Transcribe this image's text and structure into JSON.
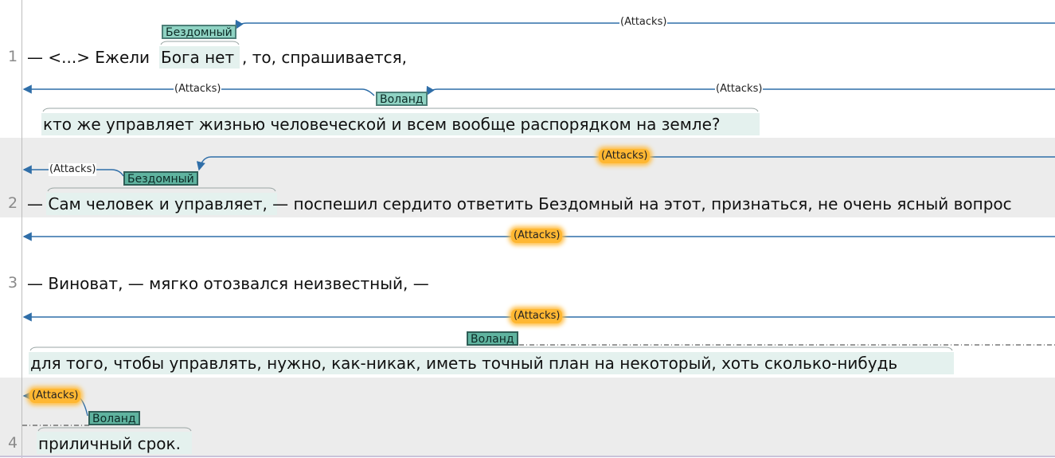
{
  "lines": [
    {
      "number": "1"
    },
    {
      "number": "2"
    },
    {
      "number": "3"
    },
    {
      "number": "4"
    }
  ],
  "sentences": {
    "s1a": "— <...> Ежели",
    "s1b": "Бога нет",
    "s1c": ", то, спрашивается,",
    "s1d": "кто же управляет жизнью человеческой и всем вообще распорядком на земле?",
    "s2a": "— Сам человек и управляет, — поспешил сердито ответить Бездомный на этот, признаться, не очень ясный вопрос",
    "s3a": "— Виноват, — мягко отозвался неизвестный, —",
    "s3b": "для того, чтобы управлять, нужно, как-никак, иметь точный план на некоторый, хоть сколько-нибудь",
    "s4a": "приличный срок."
  },
  "entities": {
    "e1": "Бездомный",
    "e2": "Воланд",
    "e3": "Бездомный",
    "e4": "Воланд",
    "e5": "Воланд"
  },
  "relations": {
    "r1": "(Attacks)",
    "r2": "(Attacks)",
    "r3": "(Attacks)",
    "r4": "(Attacks)",
    "r5": "(Attacks)",
    "r6": "(Attacks)",
    "r7": "(Attacks)",
    "r8": "(Attacks)"
  },
  "colors": {
    "arc": "#2f6ea8",
    "entity_fill": "#8fd3c3",
    "entity_border": "#4d7f78",
    "highlight_relation": "#ffb732",
    "shaded_row": "#ececec"
  }
}
